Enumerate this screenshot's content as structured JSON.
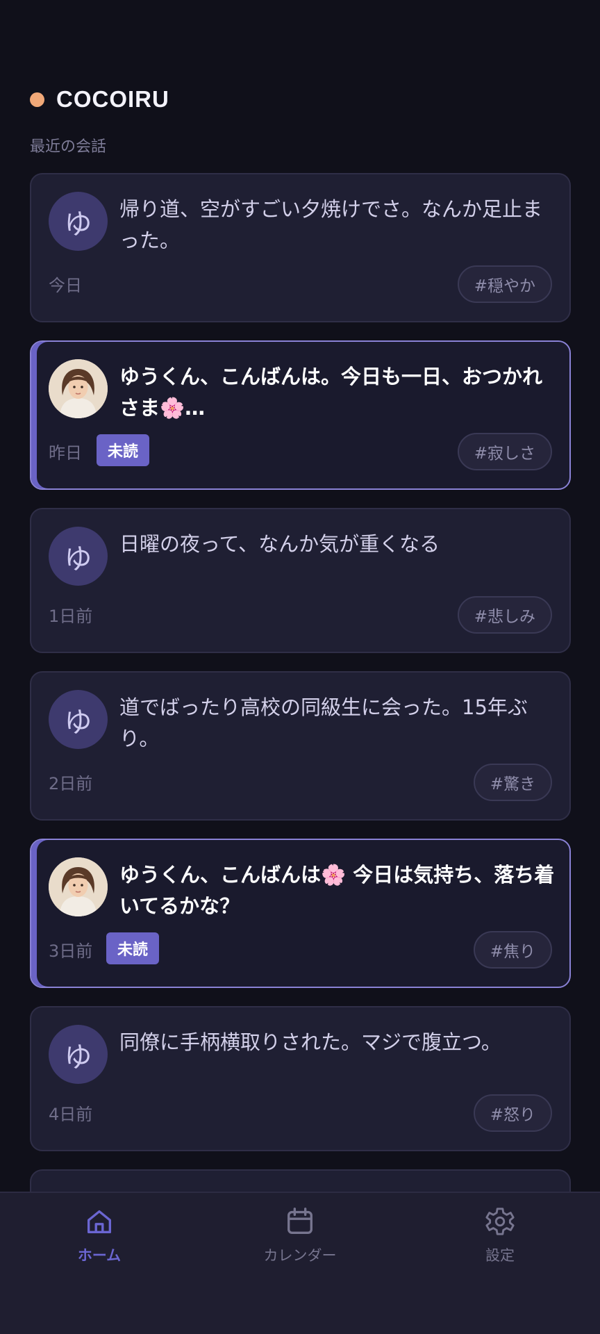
{
  "app": {
    "brand": "COCOIRU",
    "brand_color": "#f0a878",
    "accent_color": "#6a63c6"
  },
  "section": {
    "label": "最近の会話"
  },
  "conversations": [
    {
      "avatar_letter": "ゆ",
      "avatar_type": "letter",
      "message": "帰り道、空がすごい夕焼けでさ。なんか足止まった。",
      "date": "今日",
      "tag": "#穏やか",
      "unread": false
    },
    {
      "avatar_type": "photo",
      "message": "ゆうくん、こんばんは。今日も一日、おつかれさま🌸…",
      "date": "昨日",
      "badge": "未読",
      "tag": "#寂しさ",
      "unread": true
    },
    {
      "avatar_letter": "ゆ",
      "avatar_type": "letter",
      "message": "日曜の夜って、なんか気が重くなる",
      "date": "1日前",
      "tag": "#悲しみ",
      "unread": false
    },
    {
      "avatar_letter": "ゆ",
      "avatar_type": "letter",
      "message": "道でばったり高校の同級生に会った。15年ぶり。",
      "date": "2日前",
      "tag": "#驚き",
      "unread": false
    },
    {
      "avatar_type": "photo",
      "message": "ゆうくん、こんばんは🌸 今日は気持ち、落ち着いてるかな？",
      "date": "3日前",
      "badge": "未読",
      "tag": "#焦り",
      "unread": true
    },
    {
      "avatar_letter": "ゆ",
      "avatar_type": "letter",
      "message": "同僚に手柄横取りされた。マジで腹立つ。",
      "date": "4日前",
      "tag": "#怒り",
      "unread": false
    }
  ],
  "nav": {
    "items": [
      {
        "label": "ホーム",
        "icon": "home-icon",
        "active": true
      },
      {
        "label": "カレンダー",
        "icon": "calendar-icon",
        "active": false
      },
      {
        "label": "設定",
        "icon": "gear-icon",
        "active": false
      }
    ]
  }
}
